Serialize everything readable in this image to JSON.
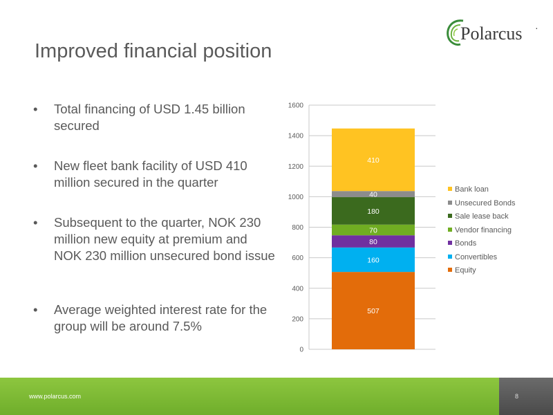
{
  "slide": {
    "title": "Improved financial position",
    "footer_url": "www.polarcus.com",
    "page_number": "8"
  },
  "logo": {
    "text": "Polarcus",
    "mark": "·"
  },
  "bullets": [
    {
      "text": "Total financing of USD 1.45 billion secured"
    },
    {
      "text": "New fleet bank facility of USD 410 million secured in the quarter"
    },
    {
      "text": "Subsequent to the quarter, NOK 230 million new equity at premium and NOK 230 million unsecured bond issue"
    },
    {
      "text": "Average weighted interest rate for the group will be around 7.5%"
    }
  ],
  "bullet_symbol": "•",
  "colors": {
    "footer_green": "#7ab935",
    "footer_dark": "#595959"
  },
  "chart_data": {
    "type": "bar",
    "stacked": true,
    "title": "",
    "xlabel": "",
    "ylabel": "",
    "ylim": [
      0,
      1600
    ],
    "y_ticks": [
      "0",
      "200",
      "400",
      "600",
      "800",
      "1000",
      "1200",
      "1400",
      "1600"
    ],
    "grid": true,
    "legend_position": "right",
    "series": [
      {
        "name": "Equity",
        "value": 507,
        "label": "507",
        "color": "#e36c0a"
      },
      {
        "name": "Convertibles",
        "value": 160,
        "label": "160",
        "color": "#00b0f0"
      },
      {
        "name": "Bonds",
        "value": 80,
        "label": "80",
        "color": "#7030a0"
      },
      {
        "name": "Vendor financing",
        "value": 70,
        "label": "70",
        "color": "#70ad22"
      },
      {
        "name": "Sale lease back",
        "value": 180,
        "label": "180",
        "color": "#3b6a1e"
      },
      {
        "name": "Unsecured Bonds",
        "value": 40,
        "label": "40",
        "color": "#8c8c8c"
      },
      {
        "name": "Bank loan",
        "value": 410,
        "label": "410",
        "color": "#ffc322"
      }
    ]
  }
}
